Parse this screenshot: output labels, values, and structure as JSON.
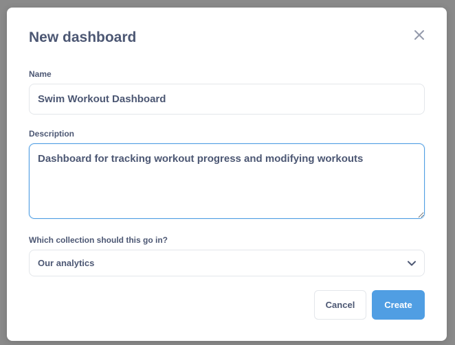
{
  "modal": {
    "title": "New dashboard",
    "close_icon": "close-icon"
  },
  "name_field": {
    "label": "Name",
    "value": "Swim Workout Dashboard"
  },
  "description_field": {
    "label": "Description",
    "value": "Dashboard for tracking workout progress and modifying workouts"
  },
  "collection_field": {
    "label": "Which collection should this go in?",
    "selected": "Our analytics",
    "icon": "chevron-down-icon"
  },
  "actions": {
    "cancel_label": "Cancel",
    "create_label": "Create"
  },
  "colors": {
    "accent": "#509ee3",
    "text": "#4c5773",
    "border": "#e3e6ea",
    "backdrop": "#8a8a8a"
  }
}
